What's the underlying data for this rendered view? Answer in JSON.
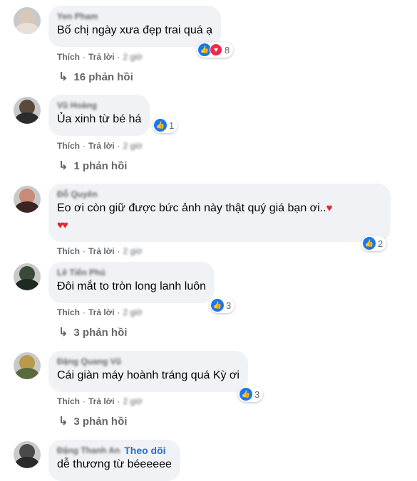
{
  "actions": {
    "like": "Thích",
    "reply": "Trả lời",
    "separator": "·"
  },
  "comments": [
    {
      "author": "Yen Pham",
      "text": "Bố chị ngày xưa đẹp trai quá ạ",
      "time": "2 giờ",
      "reactions": {
        "types": [
          "like",
          "love"
        ],
        "count": "8"
      },
      "replies": "16 phản hồi",
      "avatar_colors": [
        "#d9c7b8",
        "#e8e0d8"
      ]
    },
    {
      "author": "Vũ Hoàng",
      "text": "Ủa xinh từ bé há",
      "time": "2 giờ",
      "reactions": {
        "types": [
          "like"
        ],
        "count": "1"
      },
      "replies": "1 phản hồi",
      "avatar_colors": [
        "#5a4a3e",
        "#2c2c2c"
      ]
    },
    {
      "author": "Đỗ Quyên",
      "text": "Eo ơi còn giữ được bức ảnh này thật quý giá bạn ơi..",
      "hearts_inline": "♥",
      "hearts_line": "♥♥",
      "time": "2 giờ",
      "reactions": {
        "types": [
          "like"
        ],
        "count": "2"
      },
      "avatar_colors": [
        "#c98a7a",
        "#3a2520"
      ]
    },
    {
      "author": "Lê Tiến Phú",
      "text": "Đôi mắt to tròn long lanh luôn",
      "time": "2 giờ",
      "reactions": {
        "types": [
          "like"
        ],
        "count": "3"
      },
      "replies": "3 phản hồi",
      "avatar_colors": [
        "#3a4a3a",
        "#1d2a22"
      ]
    },
    {
      "author": "Đặng Quang Vũ",
      "text": "Cái giàn máy hoành tráng quá Kỳ ơi",
      "time": "2 giờ",
      "reactions": {
        "types": [
          "like"
        ],
        "count": "3"
      },
      "replies": "3 phản hồi",
      "avatar_colors": [
        "#b89a4a",
        "#5a6a3a"
      ]
    },
    {
      "author": "Đặng Thanh An",
      "follow": "Theo dõi",
      "text": "dễ thương từ béeeeee",
      "avatar_colors": [
        "#4a4a4a",
        "#2a2a2a"
      ]
    }
  ],
  "colors": {
    "like": "#1877f2",
    "love": "#f0284a",
    "follow": "#216fdb",
    "bubble": "#f0f2f5",
    "meta": "#65676b"
  },
  "icons": {
    "like": "thumbs-up-icon",
    "love": "heart-icon",
    "reply": "reply-arrow-icon"
  }
}
